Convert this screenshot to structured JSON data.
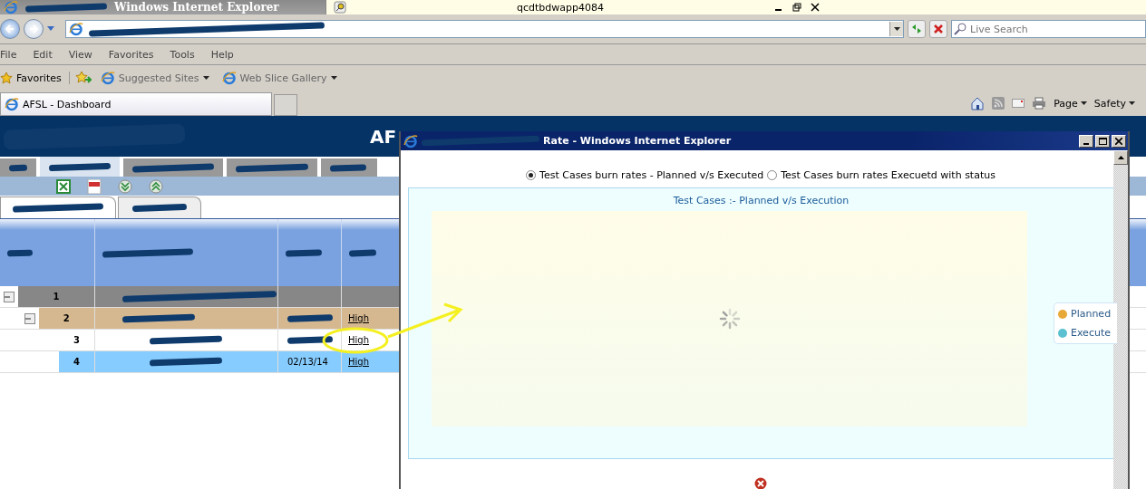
{
  "browser": {
    "title": "Windows Internet Explorer",
    "tab_host": "qcdtbdwapp4084",
    "search": {
      "placeholder": "Live Search"
    },
    "menu": [
      "File",
      "Edit",
      "View",
      "Favorites",
      "Tools",
      "Help"
    ],
    "favorites_label": "Favorites",
    "favorites_links": [
      "Suggested Sites",
      "Web Slice Gallery"
    ],
    "tab": "AFSL - Dashboard",
    "command_menus": [
      "Page",
      "Safety"
    ]
  },
  "app": {
    "header_title": "AF",
    "nav_tabs": [
      {
        "selected": false
      },
      {
        "selected": true
      },
      {
        "selected": false
      },
      {
        "selected": false
      },
      {
        "selected": false
      }
    ],
    "sub_tabs": [
      {
        "selected": true
      },
      {
        "selected": false
      }
    ],
    "rows": [
      {
        "sl_no": "1",
        "expanded": true,
        "selected": false,
        "children": [
          {
            "sl_no": "2",
            "expanded": true,
            "selected": false,
            "confidence": "High",
            "children": [
              {
                "sl_no": "3",
                "selected": false,
                "confidence": "High"
              },
              {
                "sl_no": "4",
                "selected": true,
                "date": "02/13/14",
                "confidence": "High"
              }
            ]
          }
        ]
      }
    ]
  },
  "popup": {
    "title": "Rate - Windows Internet Explorer",
    "radios": [
      {
        "label": "Test Cases burn rates - Planned v/s Executed",
        "selected": true
      },
      {
        "label": "Test Cases burn rates Execuetd with status",
        "selected": false
      }
    ],
    "chart": {
      "title": "Test Cases :- Planned v/s Execution",
      "legend": [
        {
          "label": "Planned",
          "color": "#e8a838"
        },
        {
          "label": "Execute",
          "color": "#5bc0d0"
        }
      ]
    }
  }
}
